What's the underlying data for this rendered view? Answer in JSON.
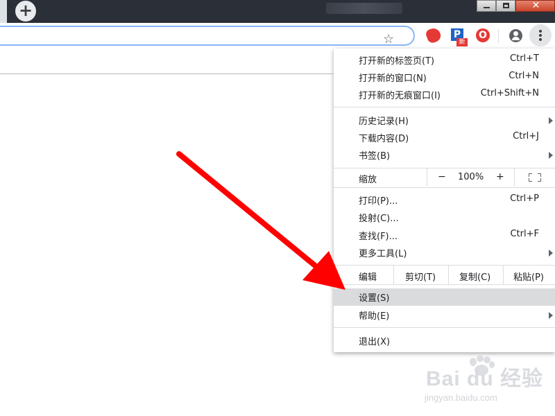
{
  "browser": {
    "new_tab_symbol": "+",
    "window_buttons": {
      "close_symbol": "✕"
    },
    "toolbar": {
      "bookmark_star": "☆",
      "extensions": [
        {
          "icon": "red-blob-icon"
        },
        {
          "icon": "p-extension-icon",
          "text": "P",
          "badge": "新"
        },
        {
          "icon": "opera-o-icon",
          "text": "O"
        }
      ],
      "menu_button_icon": "three-dots-vertical-icon"
    }
  },
  "menu": {
    "items_group1": [
      {
        "label": "打开新的标签页(T)",
        "shortcut": "Ctrl+T"
      },
      {
        "label": "打开新的窗口(N)",
        "shortcut": "Ctrl+N"
      },
      {
        "label": "打开新的无痕窗口(I)",
        "shortcut": "Ctrl+Shift+N"
      }
    ],
    "items_group2": [
      {
        "label": "历史记录(H)",
        "submenu": true
      },
      {
        "label": "下载内容(D)",
        "shortcut": "Ctrl+J"
      },
      {
        "label": "书签(B)",
        "submenu": true
      }
    ],
    "zoom": {
      "label": "缩放",
      "minus": "−",
      "value": "100%",
      "plus": "+"
    },
    "items_group3": [
      {
        "label": "打印(P)...",
        "shortcut": "Ctrl+P"
      },
      {
        "label": "投射(C)..."
      },
      {
        "label": "查找(F)...",
        "shortcut": "Ctrl+F"
      },
      {
        "label": "更多工具(L)",
        "submenu": true
      }
    ],
    "edit": {
      "label": "编辑",
      "cut": "剪切(T)",
      "copy": "复制(C)",
      "paste": "粘贴(P)"
    },
    "items_group4": [
      {
        "label": "设置(S)",
        "highlighted": true
      },
      {
        "label": "帮助(E)",
        "submenu": true
      }
    ],
    "exit": {
      "label": "退出(X)"
    }
  },
  "annotation": {
    "arrow_color": "#ff0000"
  },
  "watermark": {
    "text": "Bai du 经验",
    "subtext": "jingyan.baidu.com"
  }
}
